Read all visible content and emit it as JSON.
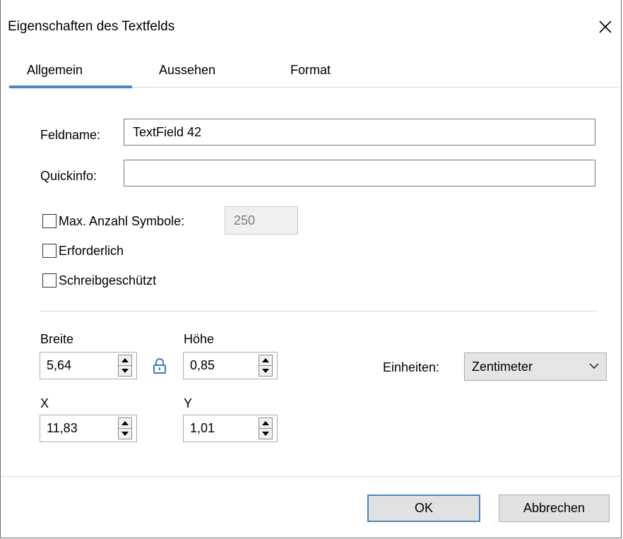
{
  "window": {
    "title": "Eigenschaften des Textfelds"
  },
  "tabs": [
    {
      "label": "Allgemein",
      "active": true
    },
    {
      "label": "Aussehen",
      "active": false
    },
    {
      "label": "Format",
      "active": false
    }
  ],
  "fields": {
    "feldname": {
      "label": "Feldname:",
      "value": "TextField 42"
    },
    "quickinfo": {
      "label": "Quickinfo:",
      "value": ""
    }
  },
  "options": {
    "max_symbols": {
      "label": "Max. Anzahl Symbole:",
      "value": "250",
      "checked": false
    },
    "required": {
      "label": "Erforderlich",
      "checked": false
    },
    "readonly": {
      "label": "Schreibgeschützt",
      "checked": false
    }
  },
  "dimensions": {
    "breite": {
      "label": "Breite",
      "value": "5,64"
    },
    "hoehe": {
      "label": "Höhe",
      "value": "0,85"
    },
    "x": {
      "label": "X",
      "value": "11,83"
    },
    "y": {
      "label": "Y",
      "value": "1,01"
    }
  },
  "units": {
    "label": "Einheiten:",
    "value": "Zentimeter"
  },
  "buttons": {
    "ok": "OK",
    "cancel": "Abbrechen"
  },
  "icons": {
    "close": "close-icon",
    "lock": "lock-icon",
    "chevron": "chevron-down-icon"
  },
  "colors": {
    "accent": "#4a87c5",
    "lock": "#3c78c8"
  }
}
